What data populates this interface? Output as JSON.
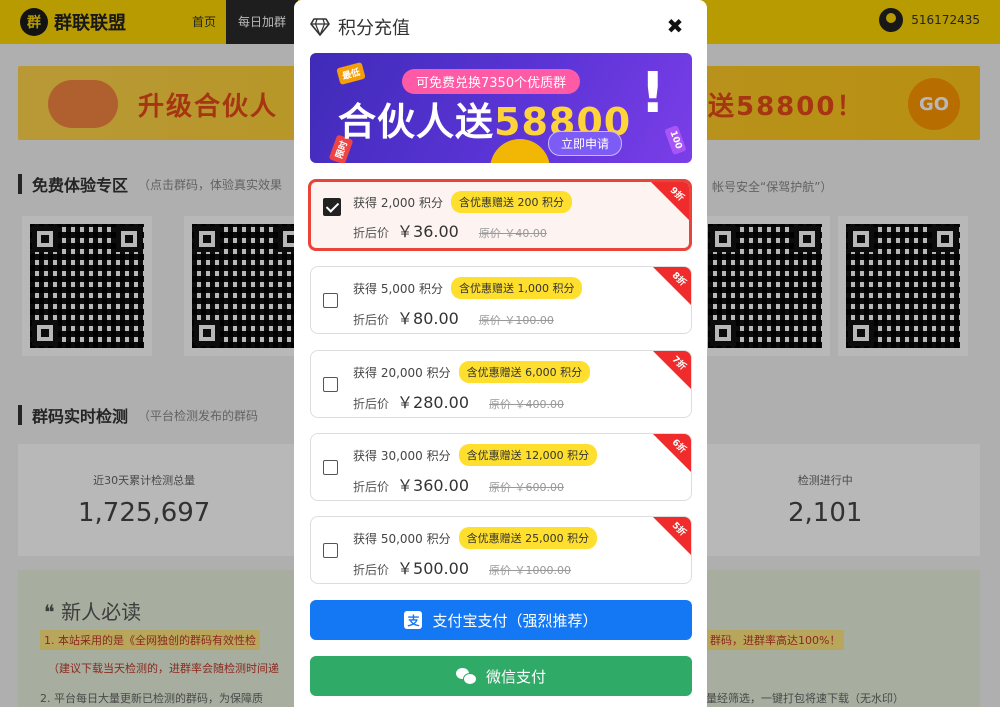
{
  "site": {
    "logo_text": "群联联盟",
    "logo_mark": "群",
    "nav_home": "首页",
    "nav_daily": "每日加群",
    "username": "516172435"
  },
  "banner": {
    "left_text": "升级合伙人",
    "right_text": "送58800！",
    "go": "GO"
  },
  "sections": {
    "free_title": "免费体验专区",
    "free_hint": "（点击群码，体验真实效果",
    "free_hint_right": "帐号安全“保驾护航”）",
    "detect_title": "群码实时检测",
    "detect_hint": "（平台检测发布的群码"
  },
  "stats": [
    {
      "label": "近30天累计检测总量",
      "value": "1,725,697"
    },
    {
      "label": "检测进行中",
      "value": "2,101"
    }
  ],
  "newbie": {
    "title": "❝ 新人必读",
    "line1": "1. 本站采用的是《全网独创的群码有效性检",
    "line1b": "群码，进群率高达100%！",
    "line2": "（建议下载当天检测的，进群率会随检测时间递",
    "line3": "2. 平台每日大量更新已检测的群码，为保障质",
    "line3b": "量经筛选，一键打包将速下载（无水印）"
  },
  "modal": {
    "title": "积分充值",
    "close": "✖",
    "promo": {
      "pill": "可免费兑换7350个优质群",
      "main_prefix": "合伙人送",
      "main_number": "58800",
      "bang": "!",
      "apply": "立即申请",
      "tag_a": "最低",
      "tag_b": "限时",
      "tag_c": "100"
    },
    "plans": [
      {
        "get": "获得 2,000 积分",
        "bonus": "含优惠赠送 200 积分",
        "label": "折后价",
        "price": "￥36.00",
        "orig": "原价 ￥40.00",
        "discount": "9折",
        "selected": true
      },
      {
        "get": "获得 5,000 积分",
        "bonus": "含优惠赠送 1,000 积分",
        "label": "折后价",
        "price": "￥80.00",
        "orig": "原价 ￥100.00",
        "discount": "8折",
        "selected": false
      },
      {
        "get": "获得 20,000 积分",
        "bonus": "含优惠赠送 6,000 积分",
        "label": "折后价",
        "price": "￥280.00",
        "orig": "原价 ￥400.00",
        "discount": "7折",
        "selected": false
      },
      {
        "get": "获得 30,000 积分",
        "bonus": "含优惠赠送 12,000 积分",
        "label": "折后价",
        "price": "￥360.00",
        "orig": "原价 ￥600.00",
        "discount": "6折",
        "selected": false
      },
      {
        "get": "获得 50,000 积分",
        "bonus": "含优惠赠送 25,000 积分",
        "label": "折后价",
        "price": "￥500.00",
        "orig": "原价 ￥1000.00",
        "discount": "5折",
        "selected": false
      }
    ],
    "alipay_label": "支付宝支付（强烈推荐）",
    "alipay_icon": "支",
    "wechat_label": "微信支付"
  },
  "colors": {
    "brand_yellow": "#fed700",
    "selected_border": "#e8443a",
    "alipay_blue": "#1478f5",
    "wechat_green": "#2fab67"
  },
  "icons": {
    "logo": "logo-icon",
    "user": "user-avatar-icon",
    "diamond": "diamond-icon",
    "close": "close-icon",
    "alipay": "alipay-icon",
    "wechat": "wechat-icon"
  }
}
